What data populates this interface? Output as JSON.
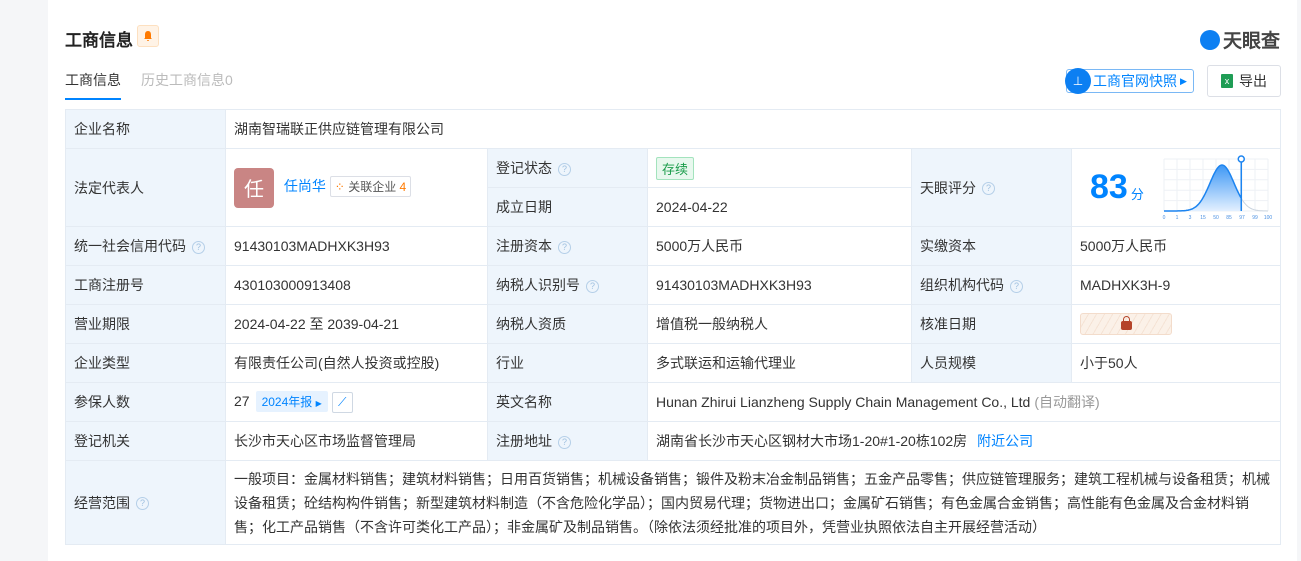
{
  "header": {
    "title": "工商信息",
    "logo_text": "天眼查"
  },
  "tabs": [
    {
      "label": "工商信息"
    },
    {
      "label": "历史工商信息0"
    }
  ],
  "actions": {
    "snapshot": "工商官网快照",
    "export": "导出"
  },
  "rows": {
    "name_label": "企业名称",
    "name": "湖南智瑞联正供应链管理有限公司",
    "rep_label": "法定代表人",
    "rep_avatar": "任",
    "rep_name": "任尚华",
    "rel_label": "关联企业",
    "rel_count": "4",
    "status_label": "登记状态",
    "status": "存续",
    "found_label": "成立日期",
    "found": "2024-04-22",
    "score_label": "天眼评分",
    "score": "83",
    "score_unit": "分",
    "score_ticks": [
      "0",
      "1",
      "3",
      "15",
      "50",
      "85",
      "97",
      "99",
      "100"
    ],
    "credit_label": "统一社会信用代码",
    "credit": "91430103MADHXK3H93",
    "cap_label": "注册资本",
    "cap": "5000万人民币",
    "paid_label": "实缴资本",
    "paid": "5000万人民币",
    "reg_label": "工商注册号",
    "reg": "430103000913408",
    "tax_label": "纳税人识别号",
    "tax": "91430103MADHXK3H93",
    "org_label": "组织机构代码",
    "org": "MADHXK3H-9",
    "term_label": "营业期限",
    "term": "2024-04-22 至 2039-04-21",
    "taxq_label": "纳税人资质",
    "taxq": "增值税一般纳税人",
    "approve_label": "核准日期",
    "type_label": "企业类型",
    "type": "有限责任公司(自然人投资或控股)",
    "ind_label": "行业",
    "ind": "多式联运和运输代理业",
    "size_label": "人员规模",
    "size": "小于50人",
    "ins_label": "参保人数",
    "ins": "27",
    "ins_report": "2024年报",
    "en_label": "英文名称",
    "en": "Hunan Zhirui Lianzheng Supply Chain Management Co., Ltd",
    "en_note": "(自动翻译)",
    "auth_label": "登记机关",
    "auth": "长沙市天心区市场监督管理局",
    "addr_label": "注册地址",
    "addr": "湖南省长沙市天心区钢材大市场1-20#1-20栋102房",
    "addr_link": "附近公司",
    "scope_label": "经营范围",
    "scope": "一般项目：金属材料销售；建筑材料销售；日用百货销售；机械设备销售；锻件及粉末冶金制品销售；五金产品零售；供应链管理服务；建筑工程机械与设备租赁；机械设备租赁；砼结构构件销售；新型建筑材料制造（不含危险化学品）；国内贸易代理；货物进出口；金属矿石销售；有色金属合金销售；高性能有色金属及合金材料销售；化工产品销售（不含许可类化工产品）；非金属矿及制品销售。（除依法须经批准的项目外，凭营业执照依法自主开展经营活动）"
  }
}
